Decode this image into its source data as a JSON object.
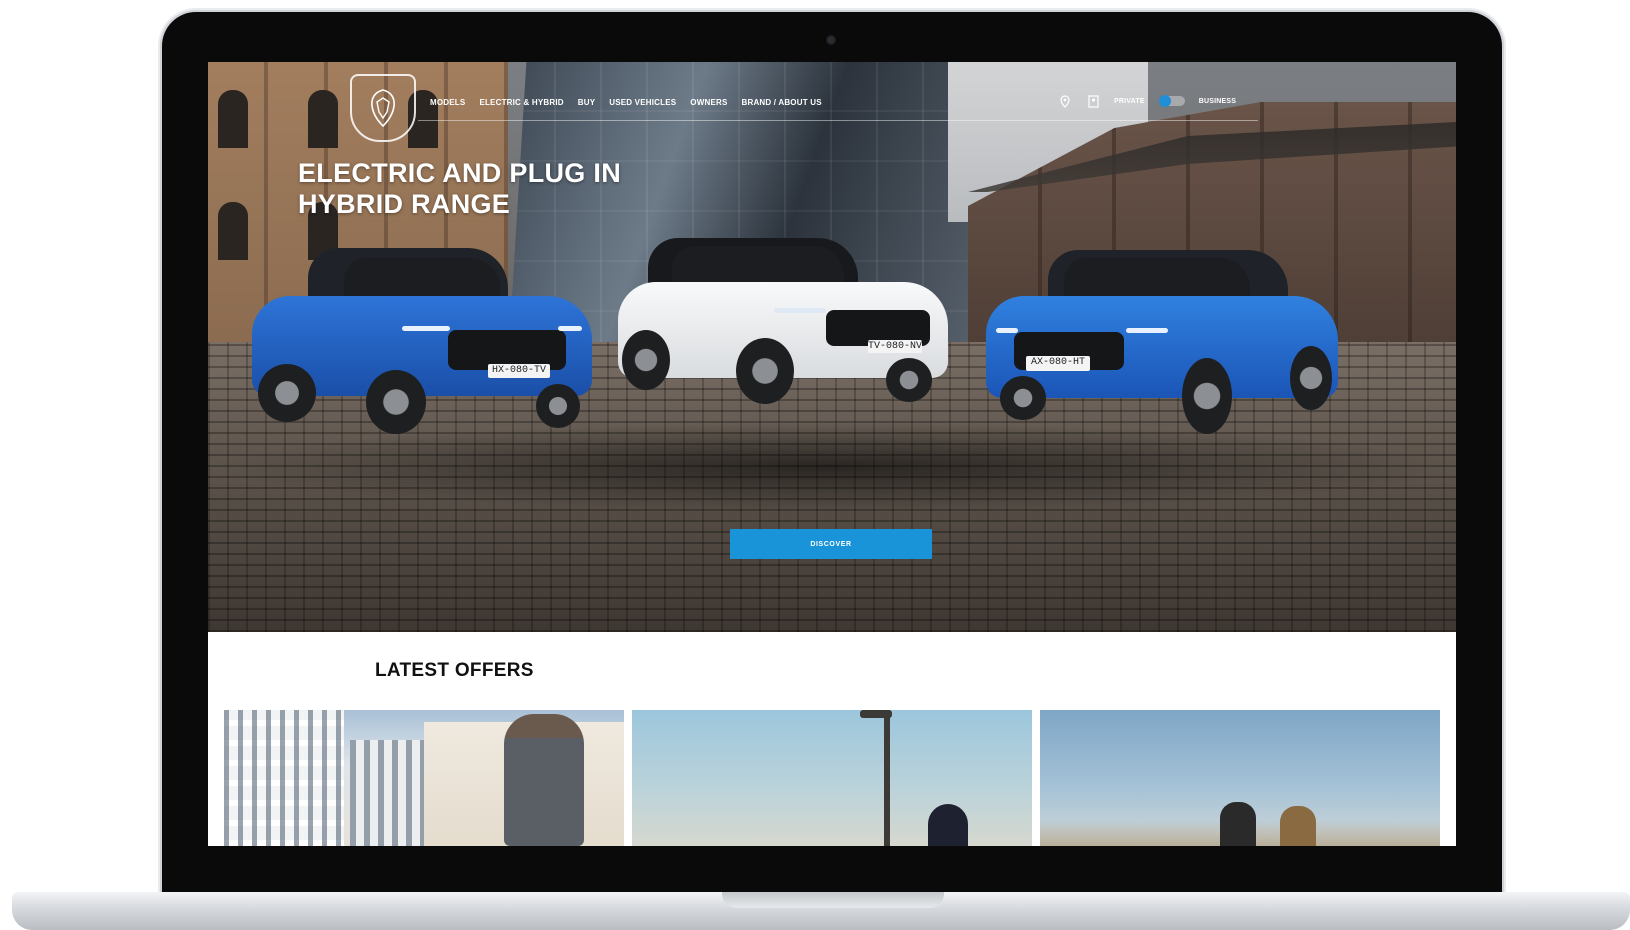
{
  "nav": {
    "items": [
      {
        "label": "MODELS"
      },
      {
        "label": "ELECTRIC & HYBRID"
      },
      {
        "label": "BUY"
      },
      {
        "label": "USED VEHICLES"
      },
      {
        "label": "OWNERS"
      },
      {
        "label": "BRAND / ABOUT US"
      }
    ],
    "location_icon": "map-pin-icon",
    "account_icon": "user-icon",
    "private_label": "PRIVATE",
    "business_label": "BUSINESS"
  },
  "hero": {
    "title": "ELECTRIC AND PLUG IN HYBRID RANGE",
    "cta_label": "DISCOVER",
    "plates": [
      "HX-080-TV",
      "TV-080-NV",
      "AX-080-HT"
    ]
  },
  "offers": {
    "title": "LATEST OFFERS"
  },
  "colors": {
    "accent": "#1a94d8",
    "car_blue": "#1d5fc4",
    "car_white": "#f1f2f3"
  }
}
